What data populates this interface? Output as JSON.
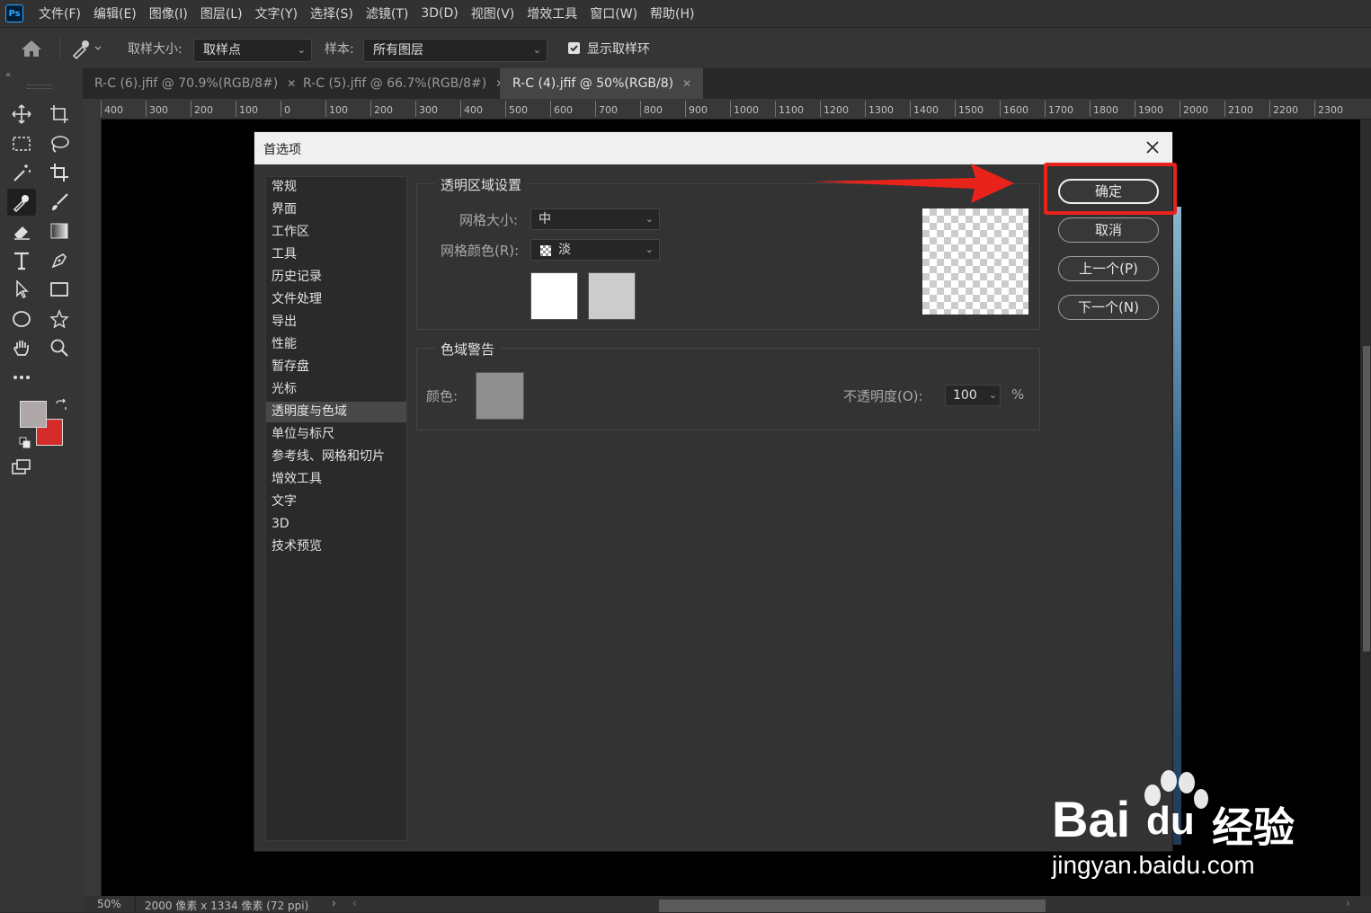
{
  "menubar": {
    "logo": "Ps",
    "items": [
      "文件(F)",
      "编辑(E)",
      "图像(I)",
      "图层(L)",
      "文字(Y)",
      "选择(S)",
      "滤镜(T)",
      "3D(D)",
      "视图(V)",
      "增效工具",
      "窗口(W)",
      "帮助(H)"
    ]
  },
  "options": {
    "sample_size_label": "取样大小:",
    "sample_size_value": "取样点",
    "sample_label": "样本:",
    "sample_value": "所有图层",
    "show_ring_label": "显示取样环",
    "show_ring_checked": true
  },
  "tabs": [
    {
      "label": "R-C (6).jfif @ 70.9%(RGB/8#)",
      "active": false
    },
    {
      "label": "R-C (5).jfif @ 66.7%(RGB/8#)",
      "active": false
    },
    {
      "label": "R-C (4).jfif @ 50%(RGB/8)",
      "active": true
    }
  ],
  "ruler": {
    "top_ticks": [
      "400",
      "300",
      "200",
      "100",
      "0",
      "100",
      "200",
      "300",
      "400",
      "500",
      "600",
      "700",
      "800",
      "900",
      "1000",
      "1100",
      "1200",
      "1300",
      "1400",
      "1500",
      "1600",
      "1700",
      "1800",
      "1900",
      "2000",
      "2100",
      "2200",
      "2300"
    ]
  },
  "status": {
    "zoom": "50%",
    "doc_info": "2000 像素 x 1334 像素 (72 ppi)"
  },
  "dialog": {
    "title": "首选项",
    "nav_items": [
      "常规",
      "界面",
      "工作区",
      "工具",
      "历史记录",
      "文件处理",
      "导出",
      "性能",
      "暂存盘",
      "光标",
      "透明度与色域",
      "单位与标尺",
      "参考线、网格和切片",
      "增效工具",
      "文字",
      "3D",
      "技术预览"
    ],
    "selected_nav": "透明度与色域",
    "transparency": {
      "group_title": "透明区域设置",
      "grid_size_label": "网格大小:",
      "grid_size_value": "中",
      "grid_color_label": "网格颜色(R):",
      "grid_color_value": "淡",
      "swatch1_color": "#ffffff",
      "swatch2_color": "#cccccc"
    },
    "gamut": {
      "group_title": "色域警告",
      "color_label": "颜色:",
      "color_value": "#8f8f8f",
      "opacity_label": "不透明度(O):",
      "opacity_value": "100",
      "opacity_unit": "%"
    },
    "buttons": {
      "ok": "确定",
      "cancel": "取消",
      "prev": "上一个(P)",
      "next": "下一个(N)"
    }
  },
  "colors": {
    "foreground": "#b0a8a8",
    "background": "#d42b2b",
    "annotation_red": "#e8231c"
  },
  "watermark": {
    "brand": "Bai",
    "brand2": "du",
    "brand_cn": "经验",
    "url": "jingyan.baidu.com"
  }
}
